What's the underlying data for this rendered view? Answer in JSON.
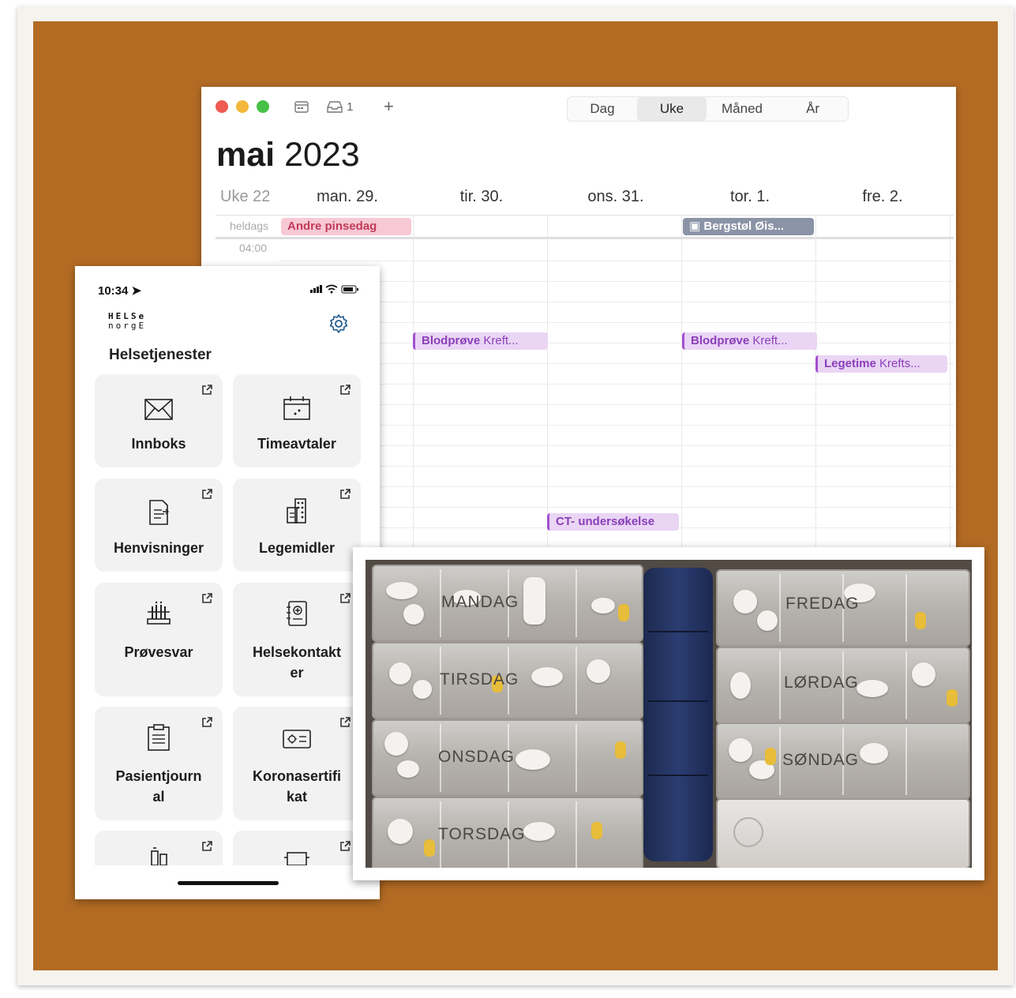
{
  "calendar": {
    "toolbar": {
      "inbox_count": "1",
      "add": "+"
    },
    "views": [
      {
        "label": "Dag",
        "selected": false
      },
      {
        "label": "Uke",
        "selected": true
      },
      {
        "label": "Måned",
        "selected": false
      },
      {
        "label": "År",
        "selected": false
      }
    ],
    "month": "mai",
    "year": "2023",
    "week_label": "Uke 22",
    "days": [
      "man. 29.",
      "tir. 30.",
      "ons. 31.",
      "tor. 1.",
      "fre. 2."
    ],
    "allday_label": "heldags",
    "time_label": "04:00",
    "allday_events": [
      {
        "title": "Andre pinsedag",
        "day": "man. 29."
      },
      {
        "title": "Bergstøl Øis...",
        "day": "tor. 1."
      }
    ],
    "events": [
      {
        "title": "Blodprøve",
        "detail": "Kreft...",
        "day": "tir. 30."
      },
      {
        "title": "Blodprøve",
        "detail": "Kreft...",
        "day": "tor. 1."
      },
      {
        "title": "Legetime",
        "detail": "Krefts...",
        "day": "fre. 2."
      },
      {
        "title": "CT- undersøkelse",
        "detail": "",
        "day": "ons. 31."
      }
    ]
  },
  "phone": {
    "time": "10:34",
    "logo_line1": "HELSe",
    "logo_line2": "norgE",
    "heading": "Helsetjenester",
    "tiles": [
      {
        "label": "Innboks",
        "icon": "envelope-icon"
      },
      {
        "label": "Timeavtaler",
        "icon": "calendar-icon"
      },
      {
        "label": "Henvisninger",
        "icon": "referral-document-icon"
      },
      {
        "label": "Legemidler",
        "icon": "pill-box-icon"
      },
      {
        "label": "Prøvesvar",
        "icon": "test-tubes-icon"
      },
      {
        "label": "Helsekontakt",
        "label2": "er",
        "icon": "contacts-book-icon"
      },
      {
        "label": "Pasientjourn",
        "label2": "al",
        "icon": "clipboard-icon"
      },
      {
        "label": "Koronasertifi",
        "label2": "kat",
        "icon": "certificate-card-icon"
      }
    ]
  },
  "pillbox": {
    "days_left": [
      "MANDAG",
      "TIRSDAG",
      "ONSDAG",
      "TORSDAG"
    ],
    "days_right": [
      "FREDAG",
      "LØRDAG",
      "SØNDAG"
    ]
  },
  "colors": {
    "board": "#b36b24",
    "allday_pink": "#f7c9d4",
    "allday_gray": "#8b93a6",
    "event_purple": "#ead5f5",
    "pill_case_blue": "#2b3d72"
  }
}
